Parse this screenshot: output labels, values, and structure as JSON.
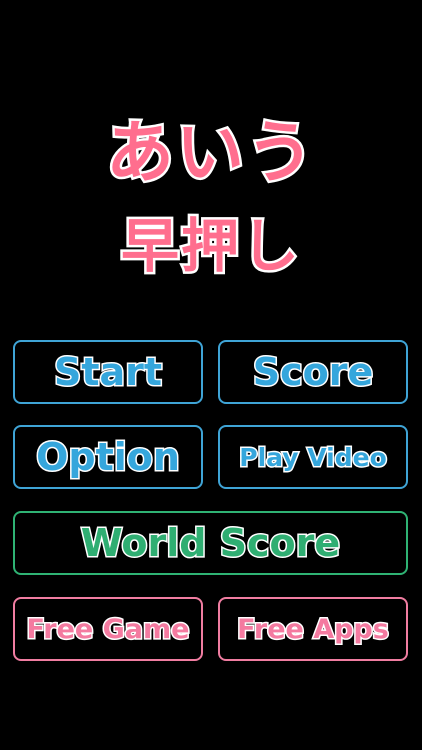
{
  "title": {
    "line1": "あいう",
    "line2": "早押し"
  },
  "menu": {
    "start": "Start",
    "score": "Score",
    "option": "Option",
    "play_video": "Play Video",
    "world_score": "World Score",
    "free_game": "Free Game",
    "free_apps": "Free Apps"
  },
  "colors": {
    "background": "#000000",
    "title": "#ff6e8e",
    "blue": "#35a6dc",
    "green": "#2fae72",
    "pink": "#f47aa0"
  }
}
